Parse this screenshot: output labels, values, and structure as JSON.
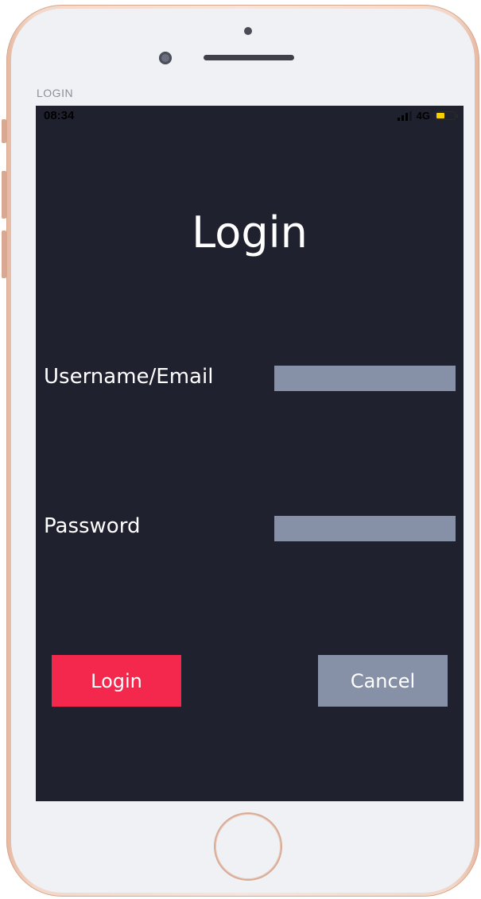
{
  "window": {
    "caption": "LOGIN"
  },
  "status_bar": {
    "time": "08:34",
    "network": "4G",
    "battery_color": "#f6d000",
    "signal_icon": "signal-bars-icon",
    "battery_icon": "battery-icon"
  },
  "login_form": {
    "title": "Login",
    "username_label": "Username/Email",
    "username_value": "",
    "password_label": "Password",
    "password_value": "",
    "login_button": "Login",
    "cancel_button": "Cancel"
  },
  "colors": {
    "screen_background": "#20212f",
    "login_button": "#f3284c",
    "cancel_button": "#8690a6",
    "input_background": "#8690a6",
    "text": "#ffffff"
  }
}
